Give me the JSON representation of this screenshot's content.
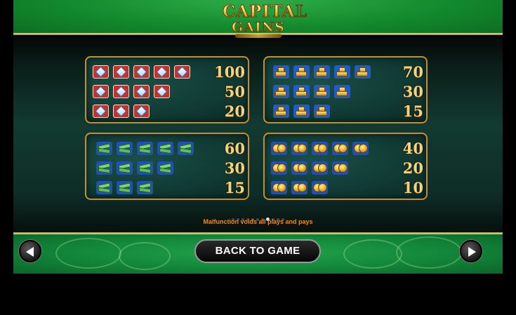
{
  "logo": {
    "line1": "CAPITAL",
    "line2": "GAINS"
  },
  "paytable": {
    "panels": [
      {
        "symbol": "diamond-icon",
        "rows": [
          {
            "count": 5,
            "payout": "100"
          },
          {
            "count": 4,
            "payout": "50"
          },
          {
            "count": 3,
            "payout": "20"
          }
        ]
      },
      {
        "symbol": "gold-bars-icon",
        "rows": [
          {
            "count": 5,
            "payout": "70"
          },
          {
            "count": 4,
            "payout": "30"
          },
          {
            "count": 3,
            "payout": "15"
          }
        ]
      },
      {
        "symbol": "cash-stack-icon",
        "rows": [
          {
            "count": 5,
            "payout": "60"
          },
          {
            "count": 4,
            "payout": "30"
          },
          {
            "count": 3,
            "payout": "15"
          }
        ]
      },
      {
        "symbol": "gold-coins-icon",
        "rows": [
          {
            "count": 5,
            "payout": "40"
          },
          {
            "count": 4,
            "payout": "20"
          },
          {
            "count": 3,
            "payout": "10"
          }
        ]
      }
    ]
  },
  "pagination": {
    "total": 11,
    "current": 8
  },
  "notice": "Malfunction voids all plays and pays",
  "footer": {
    "back_label": "BACK TO GAME",
    "prev_icon": "left-arrow-icon",
    "next_icon": "right-arrow-icon"
  },
  "colors": {
    "gold": "#c58f2b",
    "payout_text": "#f7d27a",
    "notice": "#f08a1e",
    "felt_green": "#138a2d"
  }
}
